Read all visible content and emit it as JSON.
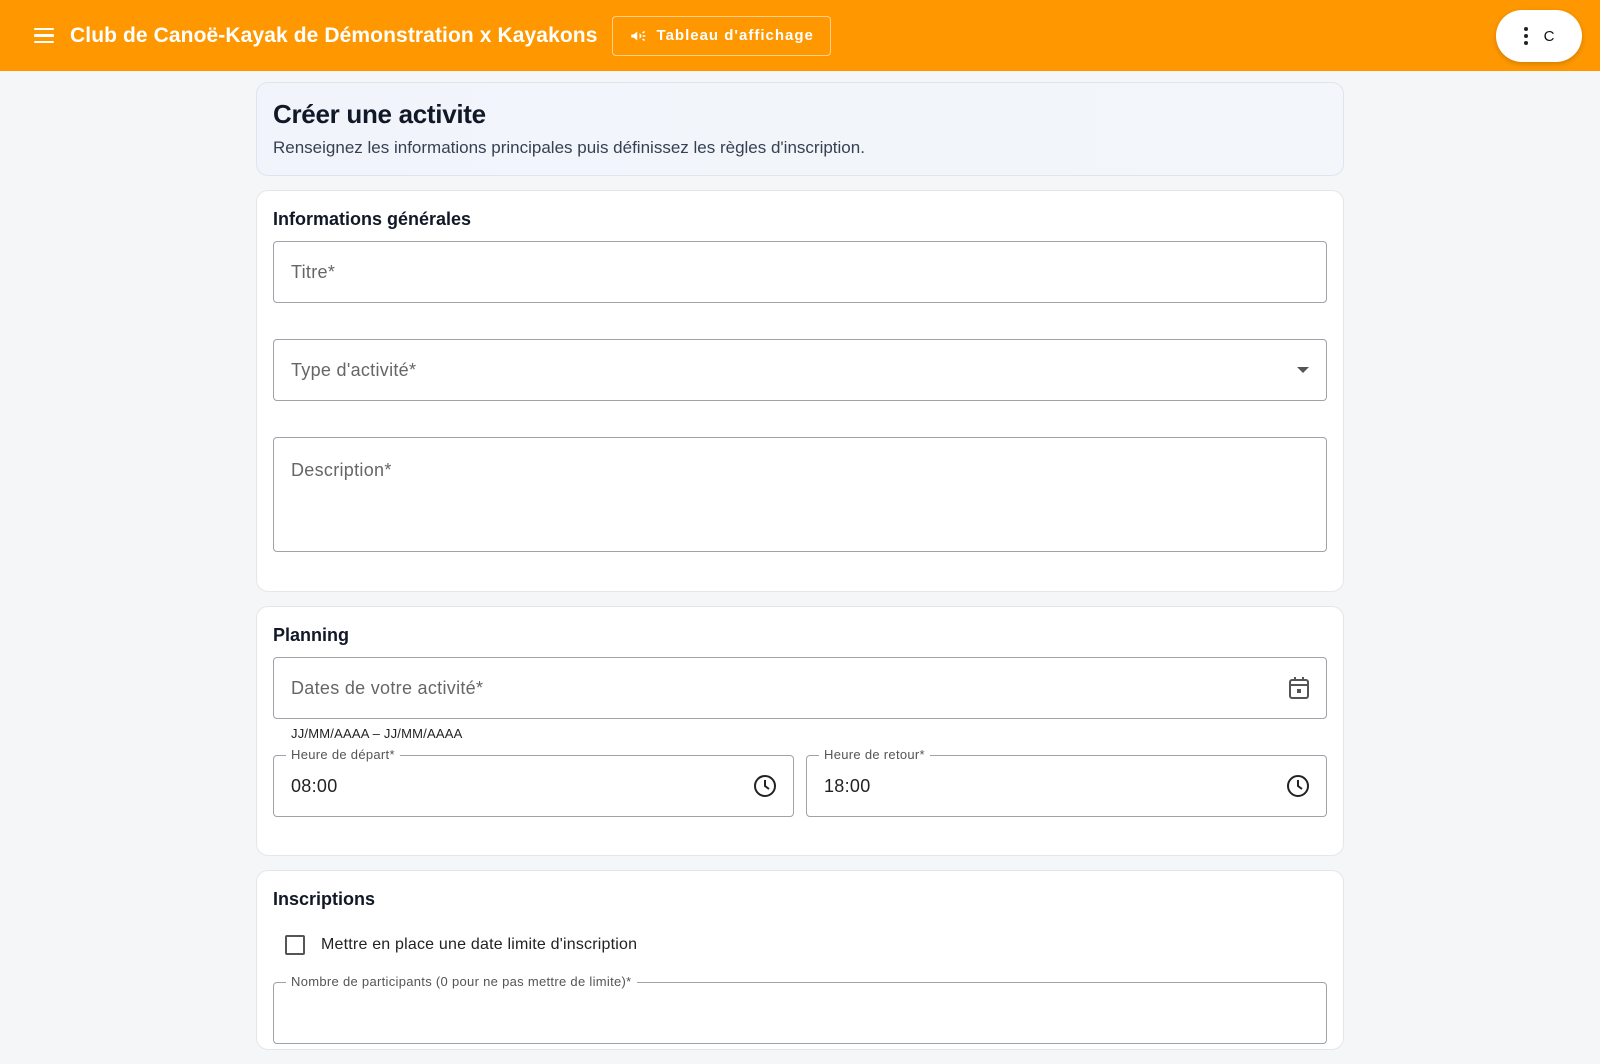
{
  "topbar": {
    "title": "Club de Canoë-Kayak de Démonstration x Kayakons",
    "board_button": "Tableau d'affichage",
    "avatar_letter": "C",
    "color": "#ff9800"
  },
  "hero": {
    "title": "Créer une activite",
    "subtitle": "Renseignez les informations principales puis définissez les règles d'inscription."
  },
  "general": {
    "section_title": "Informations générales",
    "title_placeholder": "Titre*",
    "type_placeholder": "Type d'activité*",
    "description_placeholder": "Description*"
  },
  "planning": {
    "section_title": "Planning",
    "dates_placeholder": "Dates de votre activité*",
    "dates_hint": "JJ/MM/AAAA – JJ/MM/AAAA",
    "departure_label": "Heure de départ*",
    "departure_value": "08:00",
    "return_label": "Heure de retour*",
    "return_value": "18:00"
  },
  "registrations": {
    "section_title": "Inscriptions",
    "deadline_checkbox_label": "Mettre en place une date limite d'inscription",
    "participants_label": "Nombre de participants (0 pour ne pas mettre de limite)*"
  }
}
